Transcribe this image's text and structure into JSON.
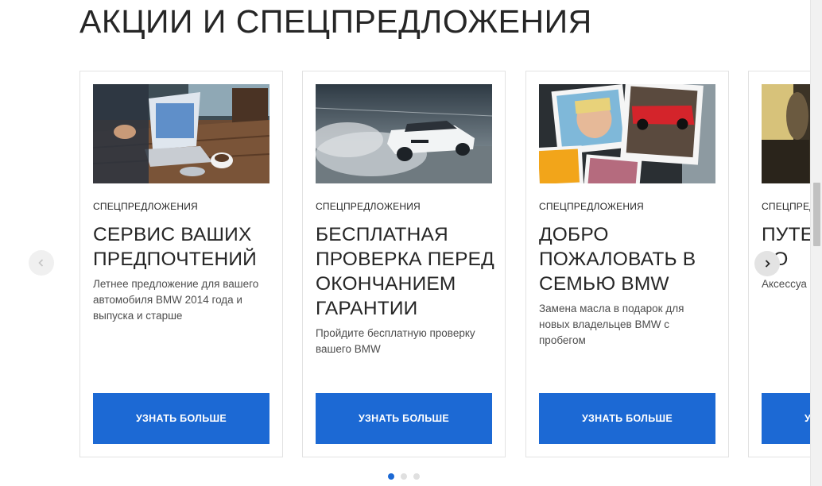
{
  "section": {
    "title": "АКЦИИ И СПЕЦПРЕДЛОЖЕНИЯ"
  },
  "cards": [
    {
      "image": "laptop-cafe-photo",
      "category": "СПЕЦПРЕДЛОЖЕНИЯ",
      "title": "СЕРВИС ВАШИХ ПРЕДПОЧТЕНИЙ",
      "description": "Летнее предложение для вашего автомобиля BMW 2014 года и выпуска и старше",
      "button": "УЗНАТЬ БОЛЬШЕ"
    },
    {
      "image": "white-bmw-drift-photo",
      "category": "СПЕЦПРЕДЛОЖЕНИЯ",
      "title": "БЕСПЛАТНАЯ ПРОВЕРКА ПЕРЕД ОКОНЧАНИЕМ ГАРАНТИИ",
      "description": "Пройдите бесплатную проверку вашего BMW",
      "button": "УЗНАТЬ БОЛЬШЕ"
    },
    {
      "image": "family-photos-collage",
      "category": "СПЕЦПРЕДЛОЖЕНИЯ",
      "title": "ДОБРО ПОЖАЛОВАТЬ В СЕМЬЮ BMW",
      "description": "Замена масла в подарок для новых владельцев BMW с пробегом",
      "button": "УЗНАТЬ БОЛЬШЕ"
    },
    {
      "image": "car-interior-photo",
      "category": "СПЕЦПРЕДЛОЖЕНИЯ",
      "title": "ПУТЕ КО",
      "description": "Аксессуа",
      "button": "УЗНАТЬ БОЛЬШЕ"
    }
  ],
  "carousel": {
    "prev_icon": "chevron-left-icon",
    "next_icon": "chevron-right-icon",
    "pages": 3,
    "active_page": 1
  },
  "colors": {
    "accent": "#1c69d4",
    "text": "#262626",
    "border": "#e2e2e2"
  }
}
